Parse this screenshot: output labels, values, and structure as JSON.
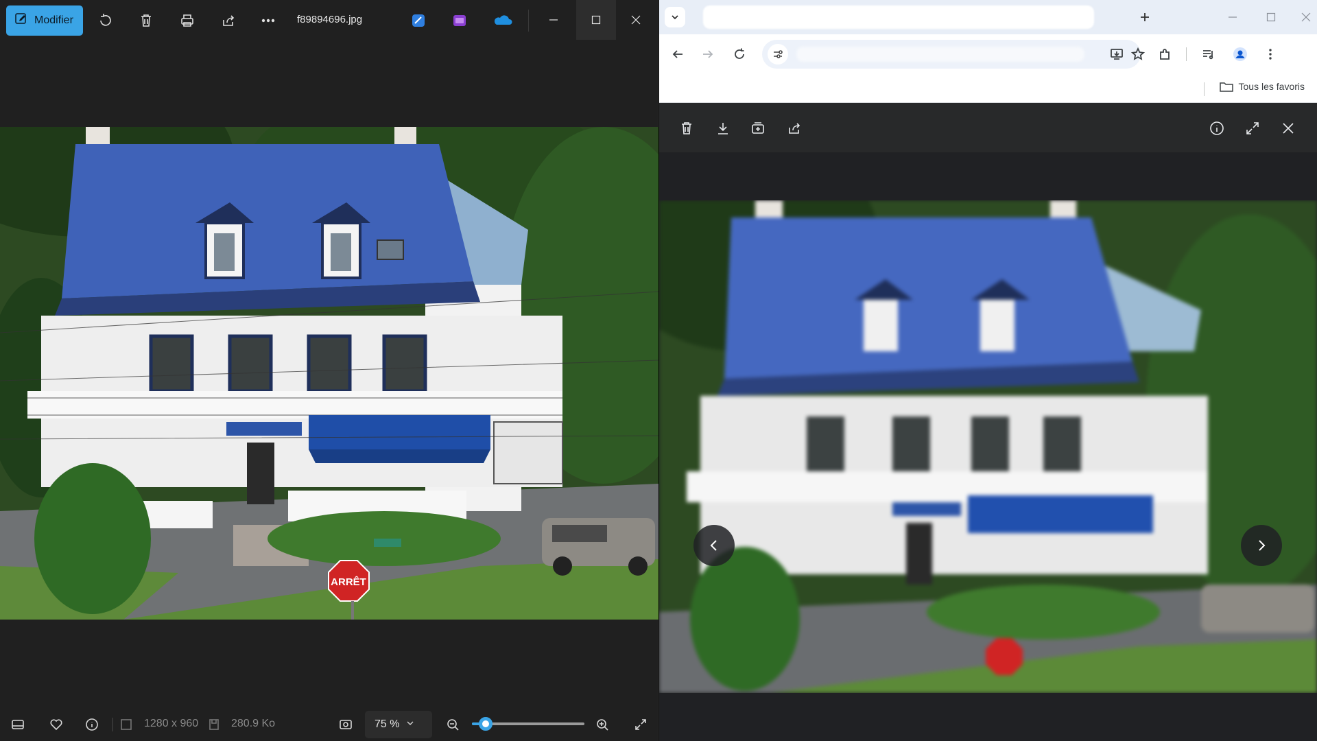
{
  "photos_app": {
    "toolbar": {
      "edit_label": "Modifier",
      "file_name": "f89894696.jpg",
      "icons": [
        "edit-pencil-icon",
        "rotate-icon",
        "delete-icon",
        "print-icon",
        "share-icon",
        "more-icon"
      ],
      "app_icons": [
        "designer-icon",
        "clipchamp-icon",
        "onedrive-icon"
      ]
    },
    "window_controls": [
      "minimize",
      "maximize",
      "close"
    ],
    "status": {
      "dimensions": "1280 x 960",
      "file_size": "280.9 Ko",
      "zoom_level": "75 %",
      "zoom_fraction": 0.12
    }
  },
  "browser": {
    "bookmarks": {
      "all_favorites_label": "Tous les favoris"
    },
    "viewer": {
      "toolbar_icons": [
        "delete-icon",
        "download-icon",
        "add-to-album-icon",
        "share-icon"
      ],
      "right_icons": [
        "info-icon",
        "fullscreen-icon",
        "close-icon"
      ]
    }
  },
  "photo": {
    "stop_sign_text": "ARRÊT",
    "colors": {
      "roof": "#3f62b8",
      "awning": "#1f4ea8",
      "trees": "#2c5a25",
      "grass": "#5f8a3a",
      "accent": "#3aa4e6"
    }
  }
}
